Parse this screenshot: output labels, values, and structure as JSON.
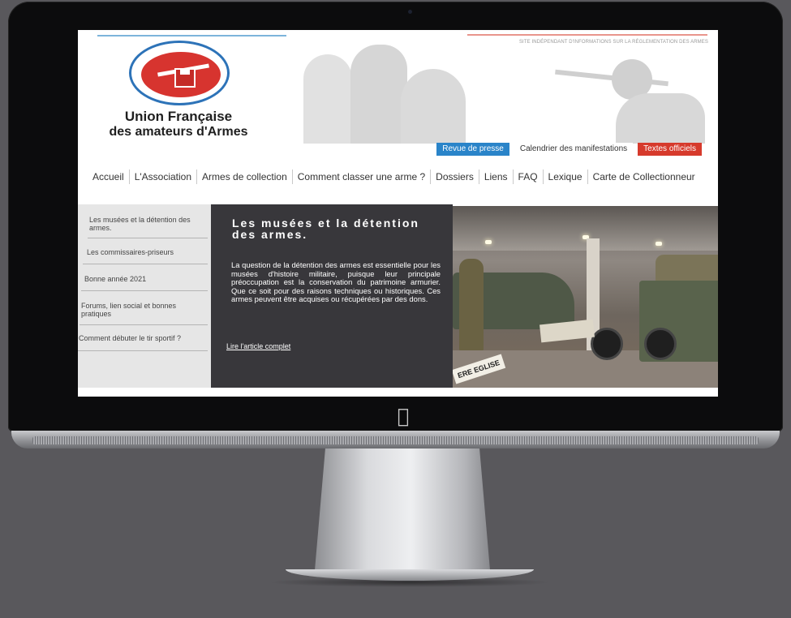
{
  "header": {
    "tagline": "SITE INDÉPENDANT D'INFORMATIONS SUR LA RÉGLEMENTATION DES ARMES",
    "logo_title": "Union Française",
    "logo_subtitle": "des amateurs d'Armes"
  },
  "quick_links": [
    {
      "label": "Revue de presse",
      "color": "#2a84c9"
    },
    {
      "label": "Calendrier des manifestations"
    },
    {
      "label": "Textes officiels",
      "color": "#d63a2c"
    }
  ],
  "nav": [
    "Accueil",
    "L'Association",
    "Armes de collection",
    "Comment classer une arme ?",
    "Dossiers",
    "Liens",
    "FAQ",
    "Lexique",
    "Carte de Collectionneur"
  ],
  "sidebar": [
    "Les musées et la détention des armes.",
    "Les commissaires-priseurs",
    "Bonne année 2021",
    "Forums, lien social et bonnes pratiques",
    "Comment débuter le tir sportif ?"
  ],
  "article": {
    "title": "Les musées et la détention des armes.",
    "text": "La question de la détention des armes est essentielle pour les musées d'histoire militaire, puisque leur principale préoccupation est la conservation du patrimoine armurier. Que ce soit pour des raisons techniques ou historiques. Ces armes peuvent être acquises ou récupérées par des dons.",
    "read_more": "Lire l'article complet",
    "photo_sign": "ERE EGLISE"
  },
  "device": {
    "apple_logo": ""
  }
}
